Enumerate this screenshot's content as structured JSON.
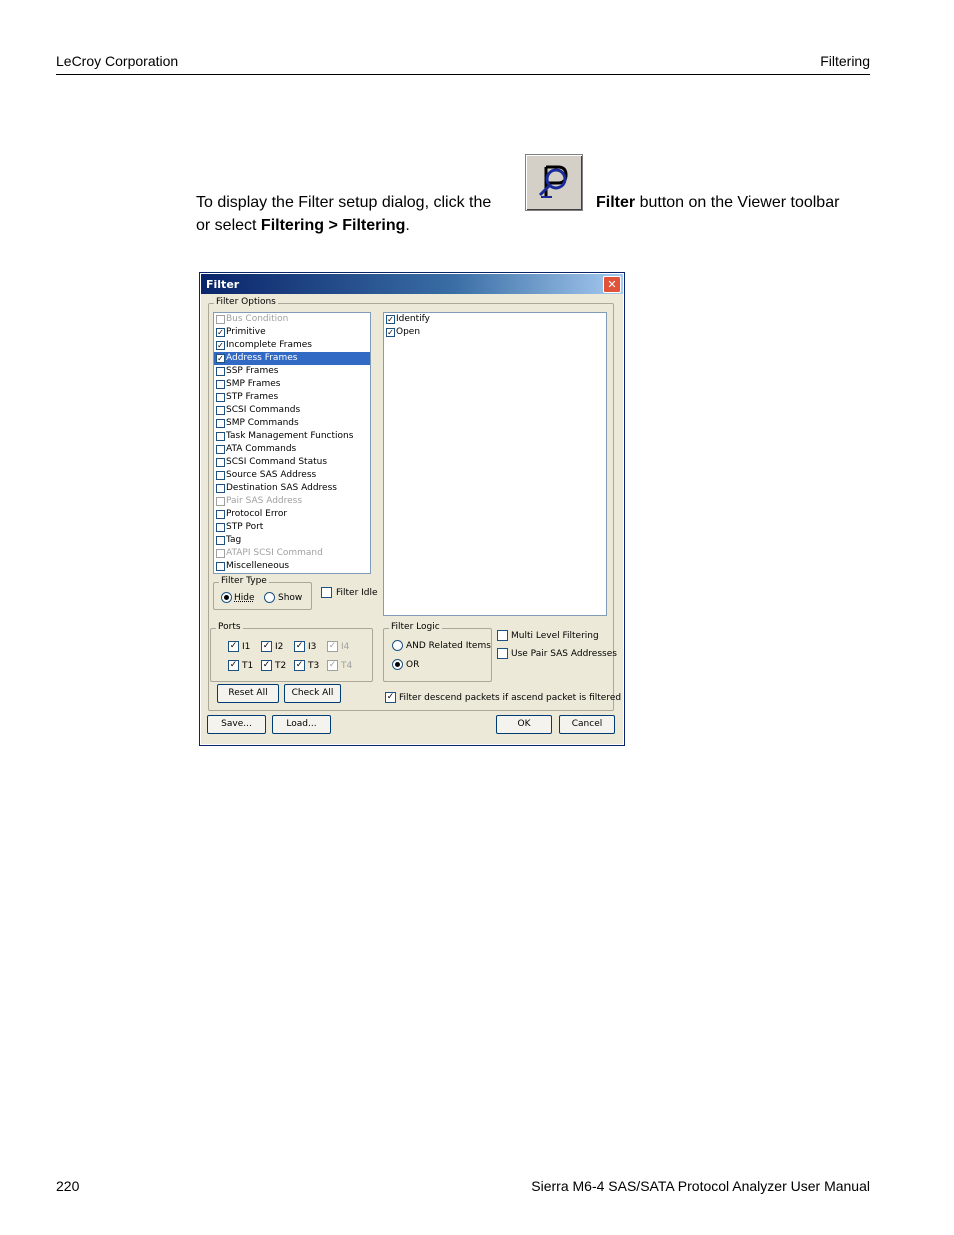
{
  "header": {
    "left": "LeCroy Corporation",
    "right": "Filtering"
  },
  "body": {
    "text_before": "To display the Filter setup dialog, click the",
    "button_name": "Filter",
    "text_after": " button on the Viewer toolbar",
    "line2_prefix": "or select ",
    "menu_path": "Filtering > Filtering",
    "line2_suffix": "."
  },
  "dialog": {
    "title": "Filter",
    "close_label": "✕",
    "filter_options_legend": "Filter Options",
    "left_list": [
      {
        "label": "Bus Condition",
        "checked": false,
        "disabled": true,
        "selected": false
      },
      {
        "label": "Primitive",
        "checked": true,
        "disabled": false,
        "selected": false
      },
      {
        "label": "Incomplete Frames",
        "checked": true,
        "disabled": false,
        "selected": false
      },
      {
        "label": "Address Frames",
        "checked": true,
        "disabled": false,
        "selected": true
      },
      {
        "label": "SSP Frames",
        "checked": false,
        "disabled": false,
        "selected": false
      },
      {
        "label": "SMP Frames",
        "checked": false,
        "disabled": false,
        "selected": false
      },
      {
        "label": "STP Frames",
        "checked": false,
        "disabled": false,
        "selected": false
      },
      {
        "label": "SCSI Commands",
        "checked": false,
        "disabled": false,
        "selected": false
      },
      {
        "label": "SMP Commands",
        "checked": false,
        "disabled": false,
        "selected": false
      },
      {
        "label": "Task Management Functions",
        "checked": false,
        "disabled": false,
        "selected": false
      },
      {
        "label": "ATA Commands",
        "checked": false,
        "disabled": false,
        "selected": false
      },
      {
        "label": "SCSI Command Status",
        "checked": false,
        "disabled": false,
        "selected": false
      },
      {
        "label": "Source SAS Address",
        "checked": false,
        "disabled": false,
        "selected": false
      },
      {
        "label": "Destination SAS Address",
        "checked": false,
        "disabled": false,
        "selected": false
      },
      {
        "label": "Pair SAS Address",
        "checked": false,
        "disabled": true,
        "selected": false
      },
      {
        "label": "Protocol Error",
        "checked": false,
        "disabled": false,
        "selected": false
      },
      {
        "label": "STP Port",
        "checked": false,
        "disabled": false,
        "selected": false
      },
      {
        "label": "Tag",
        "checked": false,
        "disabled": false,
        "selected": false
      },
      {
        "label": "ATAPI SCSI Command",
        "checked": false,
        "disabled": true,
        "selected": false
      },
      {
        "label": "Miscelleneous",
        "checked": false,
        "disabled": false,
        "selected": false
      }
    ],
    "right_list": [
      {
        "label": "Identify",
        "checked": true
      },
      {
        "label": "Open",
        "checked": true
      }
    ],
    "filter_type": {
      "legend": "Filter Type",
      "hide_label": "Hide",
      "show_label": "Show",
      "selected": "Hide"
    },
    "filter_idle_label": "Filter Idle",
    "ports": {
      "legend": "Ports",
      "row1": [
        {
          "label": "I1",
          "checked": true,
          "disabled": false
        },
        {
          "label": "I2",
          "checked": true,
          "disabled": false
        },
        {
          "label": "I3",
          "checked": true,
          "disabled": false
        },
        {
          "label": "I4",
          "checked": true,
          "disabled": true
        }
      ],
      "row2": [
        {
          "label": "T1",
          "checked": true,
          "disabled": false
        },
        {
          "label": "T2",
          "checked": true,
          "disabled": false
        },
        {
          "label": "T3",
          "checked": true,
          "disabled": false
        },
        {
          "label": "T4",
          "checked": true,
          "disabled": true
        }
      ]
    },
    "filter_logic": {
      "legend": "Filter Logic",
      "and_label": "AND Related Items",
      "or_label": "OR",
      "selected": "OR"
    },
    "multi_level_label": "Multi Level Filtering",
    "use_pair_label": "Use Pair SAS Addresses",
    "filter_descend_label": "Filter descend packets if ascend packet is filtered",
    "buttons": {
      "reset_all": "Reset All",
      "check_all": "Check All",
      "save": "Save...",
      "load": "Load...",
      "ok": "OK",
      "cancel": "Cancel"
    }
  },
  "footer": {
    "page_number": "220",
    "manual_title": "Sierra M6-4 SAS/SATA Protocol Analyzer User Manual"
  }
}
